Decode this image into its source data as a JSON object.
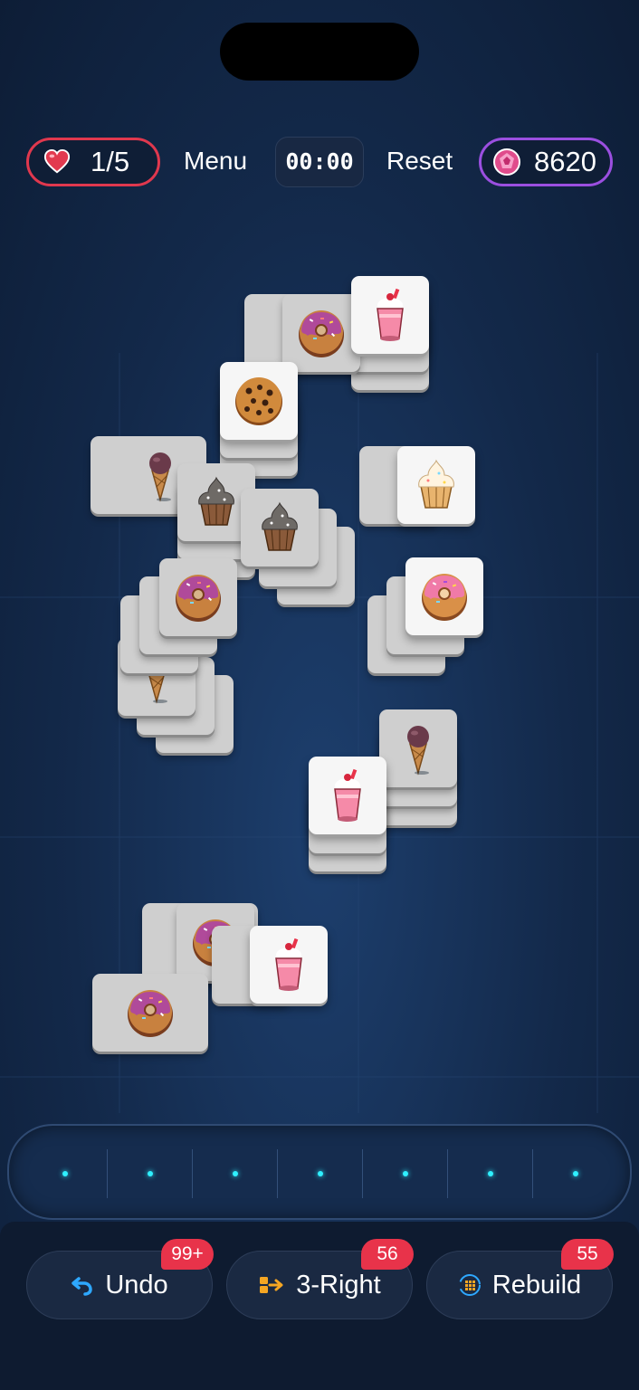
{
  "topbar": {
    "lives": "1/5",
    "menu_label": "Menu",
    "timer": "00:00",
    "reset_label": "Reset",
    "gems": "8620",
    "lives_color": "#e0384e",
    "gems_color": "#9b4fe0"
  },
  "tray": {
    "slot_count": 7,
    "filled": 0
  },
  "powerups": [
    {
      "label": "Undo",
      "badge": "99+",
      "icon": "undo-arrow-icon"
    },
    {
      "label": "3-Right",
      "badge": "56",
      "icon": "move-right-icon"
    },
    {
      "label": "Rebuild",
      "badge": "55",
      "icon": "rebuild-grid-icon"
    }
  ]
}
